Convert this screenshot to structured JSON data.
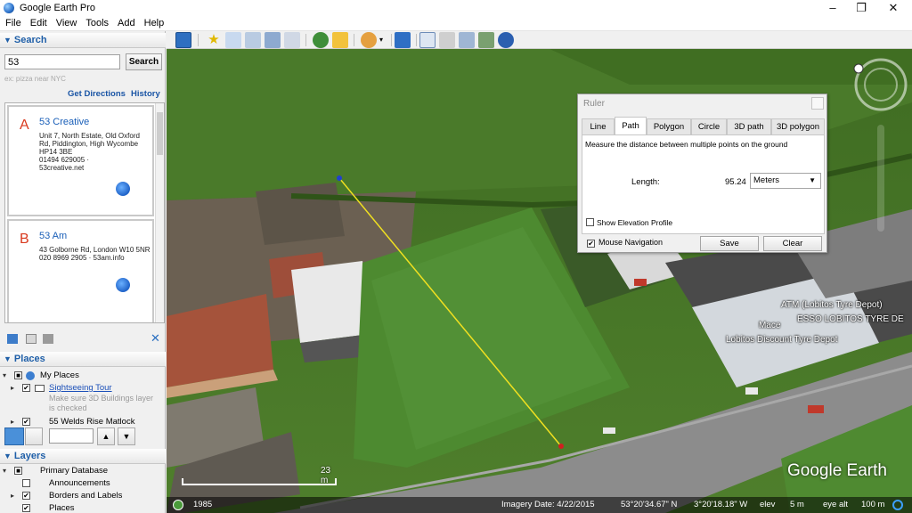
{
  "window": {
    "title": "Google Earth Pro"
  },
  "menu": {
    "items": [
      "File",
      "Edit",
      "View",
      "Tools",
      "Add",
      "Help"
    ]
  },
  "search": {
    "heading": "Search",
    "query": "53",
    "button": "Search",
    "hint": "ex: pizza near NYC",
    "get_directions": "Get Directions",
    "history": "History",
    "results": [
      {
        "letter": "A",
        "title": "53 Creative",
        "address": "Unit 7, North Estate, Old Oxford Rd, Piddington, High Wycombe HP14 3BE",
        "phone": "01494 629005 ·",
        "site": "53creative.net"
      },
      {
        "letter": "B",
        "title": "53 Am",
        "address": "43 Golborne Rd, London W10 5NR",
        "phone": "020 8969 2905 · 53am.info",
        "site": ""
      }
    ]
  },
  "places": {
    "heading": "Places",
    "items": [
      "My Places",
      "Sightseeing Tour",
      "Make sure 3D Buildings layer is checked",
      "55 Welds Rise Matlock"
    ]
  },
  "layers": {
    "heading": "Layers",
    "items": [
      "Primary Database",
      "Announcements",
      "Borders and Labels",
      "Places"
    ]
  },
  "ruler": {
    "title": "Ruler",
    "tabs": [
      "Line",
      "Path",
      "Polygon",
      "Circle",
      "3D path",
      "3D polygon"
    ],
    "active_tab": "Path",
    "description": "Measure the distance between multiple points on the ground",
    "length_label": "Length:",
    "length_value": "95.24",
    "unit": "Meters",
    "show_elevation": "Show Elevation Profile",
    "mouse_navigation": "Mouse Navigation",
    "save": "Save",
    "clear": "Clear"
  },
  "map": {
    "labels": [
      "ATM (Lobitos Tyre Depot)",
      "ESSO LOBITOS TYRE DE",
      "Mace",
      "Lobitos Discount Tyre Depot"
    ],
    "scale": "23 m",
    "brand": "Google Earth"
  },
  "status": {
    "year": "1985",
    "imagery_date": "Imagery Date: 4/22/2015",
    "lat": "53°20'34.67\" N",
    "lon": "3°20'18.18\" W",
    "elev_label": "elev",
    "elev_value": "5 m",
    "eye_alt_label": "eye alt",
    "eye_alt_value": "100 m"
  }
}
